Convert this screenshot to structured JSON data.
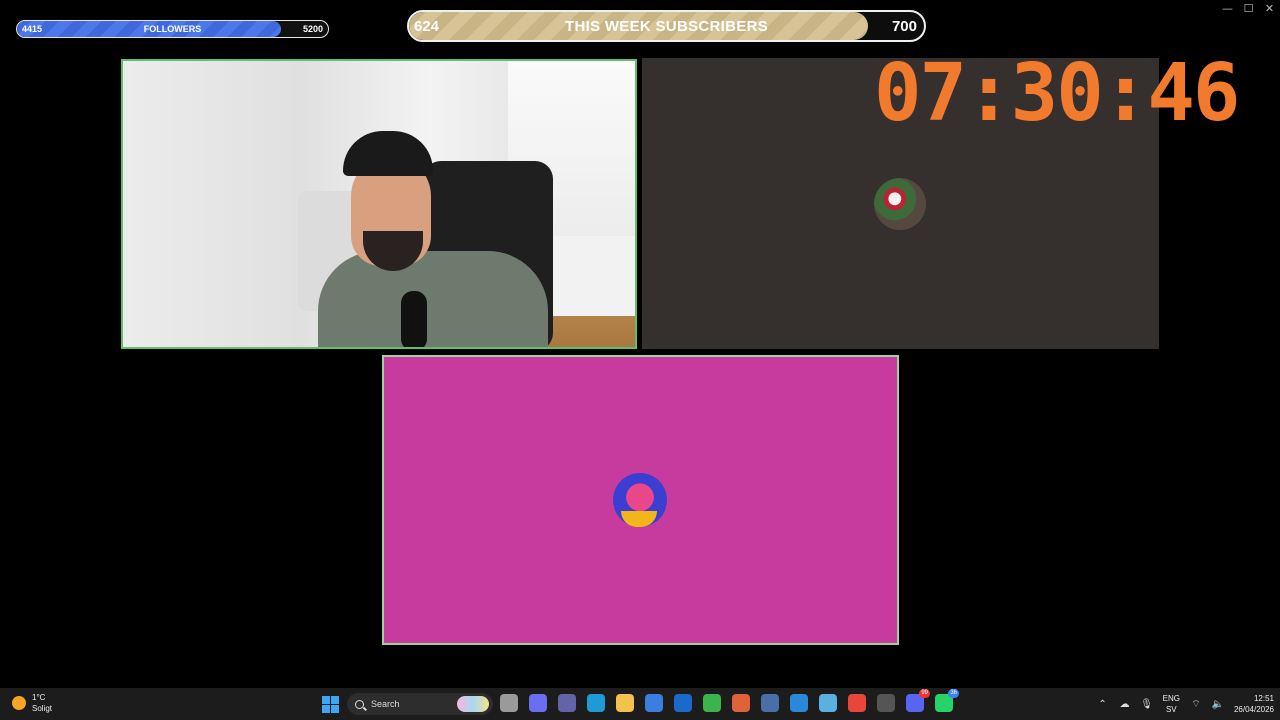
{
  "window": {
    "minimize_icon": "minimize-icon",
    "maximize_icon": "maximize-icon",
    "close_icon": "close-icon"
  },
  "followers_bar": {
    "current": "4415",
    "label": "FOLLOWERS",
    "goal": "5200",
    "progress": 0.848,
    "color": "#4c79ea"
  },
  "subscribers_bar": {
    "current": "624",
    "label": "THIS WEEK SUBSCRIBERS",
    "goal": "700",
    "progress": 0.891,
    "color": "#d6c396"
  },
  "timer": {
    "text": "07:30:46",
    "color": "#f27a2c"
  },
  "panels": {
    "camera": {
      "border_color": "#5ec16a"
    },
    "participant_dark": {
      "background": "#352f2e"
    },
    "participant_pink": {
      "background": "#c63b9d"
    }
  },
  "taskbar": {
    "weather": {
      "temp": "1°C",
      "condition": "Soligt"
    },
    "search_placeholder": "Search",
    "apps": [
      {
        "name": "file-icon",
        "color": "#9a9a9a"
      },
      {
        "name": "copilot-icon",
        "color": "#6b6ef0"
      },
      {
        "name": "teams-icon",
        "color": "#6264a7"
      },
      {
        "name": "edge-icon",
        "color": "#1e9bd7"
      },
      {
        "name": "folder-icon",
        "color": "#f2c14e"
      },
      {
        "name": "store-icon",
        "color": "#3c7de0"
      },
      {
        "name": "outlook-icon",
        "color": "#1b6ac9"
      },
      {
        "name": "vpn-icon",
        "color": "#3bb54a"
      },
      {
        "name": "m365-icon",
        "color": "#e0623a"
      },
      {
        "name": "cube-icon",
        "color": "#4a6fa8"
      },
      {
        "name": "photos-icon",
        "color": "#2b88d8"
      },
      {
        "name": "image-icon",
        "color": "#5ab0e0"
      },
      {
        "name": "chrome-icon",
        "color": "#e9463b"
      },
      {
        "name": "obs-icon",
        "color": "#555555"
      },
      {
        "name": "discord-icon",
        "color": "#5865f2",
        "badge": "99"
      },
      {
        "name": "whatsapp-icon",
        "color": "#25d366",
        "badge": "36"
      }
    ],
    "tray": {
      "language": "ENG",
      "layout": "SV",
      "time": "12:51",
      "date": "26/04/2026"
    }
  }
}
